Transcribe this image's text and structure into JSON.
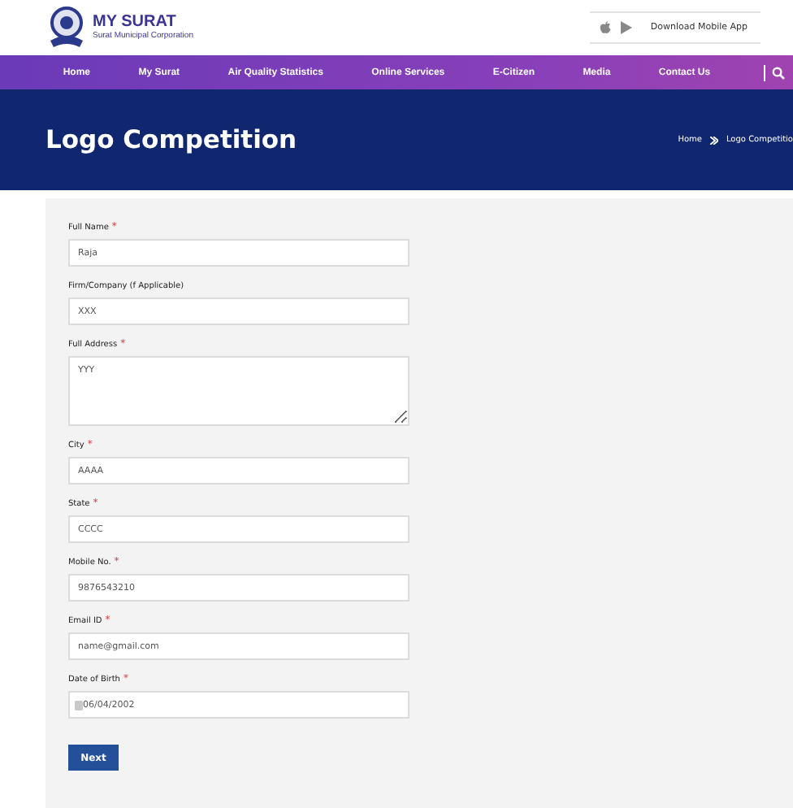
{
  "header": {
    "title": "MY SURAT",
    "subtitle": "Surat Municipal Corporation",
    "app_link": "Download Mobile App"
  },
  "nav": {
    "items": [
      {
        "label": "Home"
      },
      {
        "label": "My Surat"
      },
      {
        "label": "Air Quality Statistics"
      },
      {
        "label": "Online Services"
      },
      {
        "label": "E-Citizen"
      },
      {
        "label": "Media"
      },
      {
        "label": "Contact Us"
      }
    ]
  },
  "banner": {
    "title": "Logo Competition",
    "breadcrumb": [
      {
        "label": "Home"
      },
      {
        "label": "Logo Competitio"
      }
    ]
  },
  "form": {
    "fields": [
      {
        "kind": "text",
        "label": "Full Name",
        "mark": "*",
        "value": "Raja"
      },
      {
        "kind": "text",
        "label": "Firm/Company (f Applicable)",
        "value": "XXX"
      },
      {
        "kind": "textarea",
        "label": "Full Address",
        "mark": "*",
        "value": "YYY"
      },
      {
        "kind": "text",
        "label": "City",
        "mark": "*",
        "value": "AAAA"
      },
      {
        "kind": "text",
        "label": "State",
        "mark": "*",
        "value": "CCCC"
      },
      {
        "kind": "text",
        "label": "Mobile No.",
        "mark": "*",
        "value": "9876543210"
      },
      {
        "kind": "text",
        "label": "Email ID",
        "mark": "*",
        "value": "name@gmail.com"
      },
      {
        "kind": "date",
        "label": "Date of Birth",
        "mark": "*",
        "value": "06/04/2002"
      }
    ],
    "submit": "Next"
  }
}
